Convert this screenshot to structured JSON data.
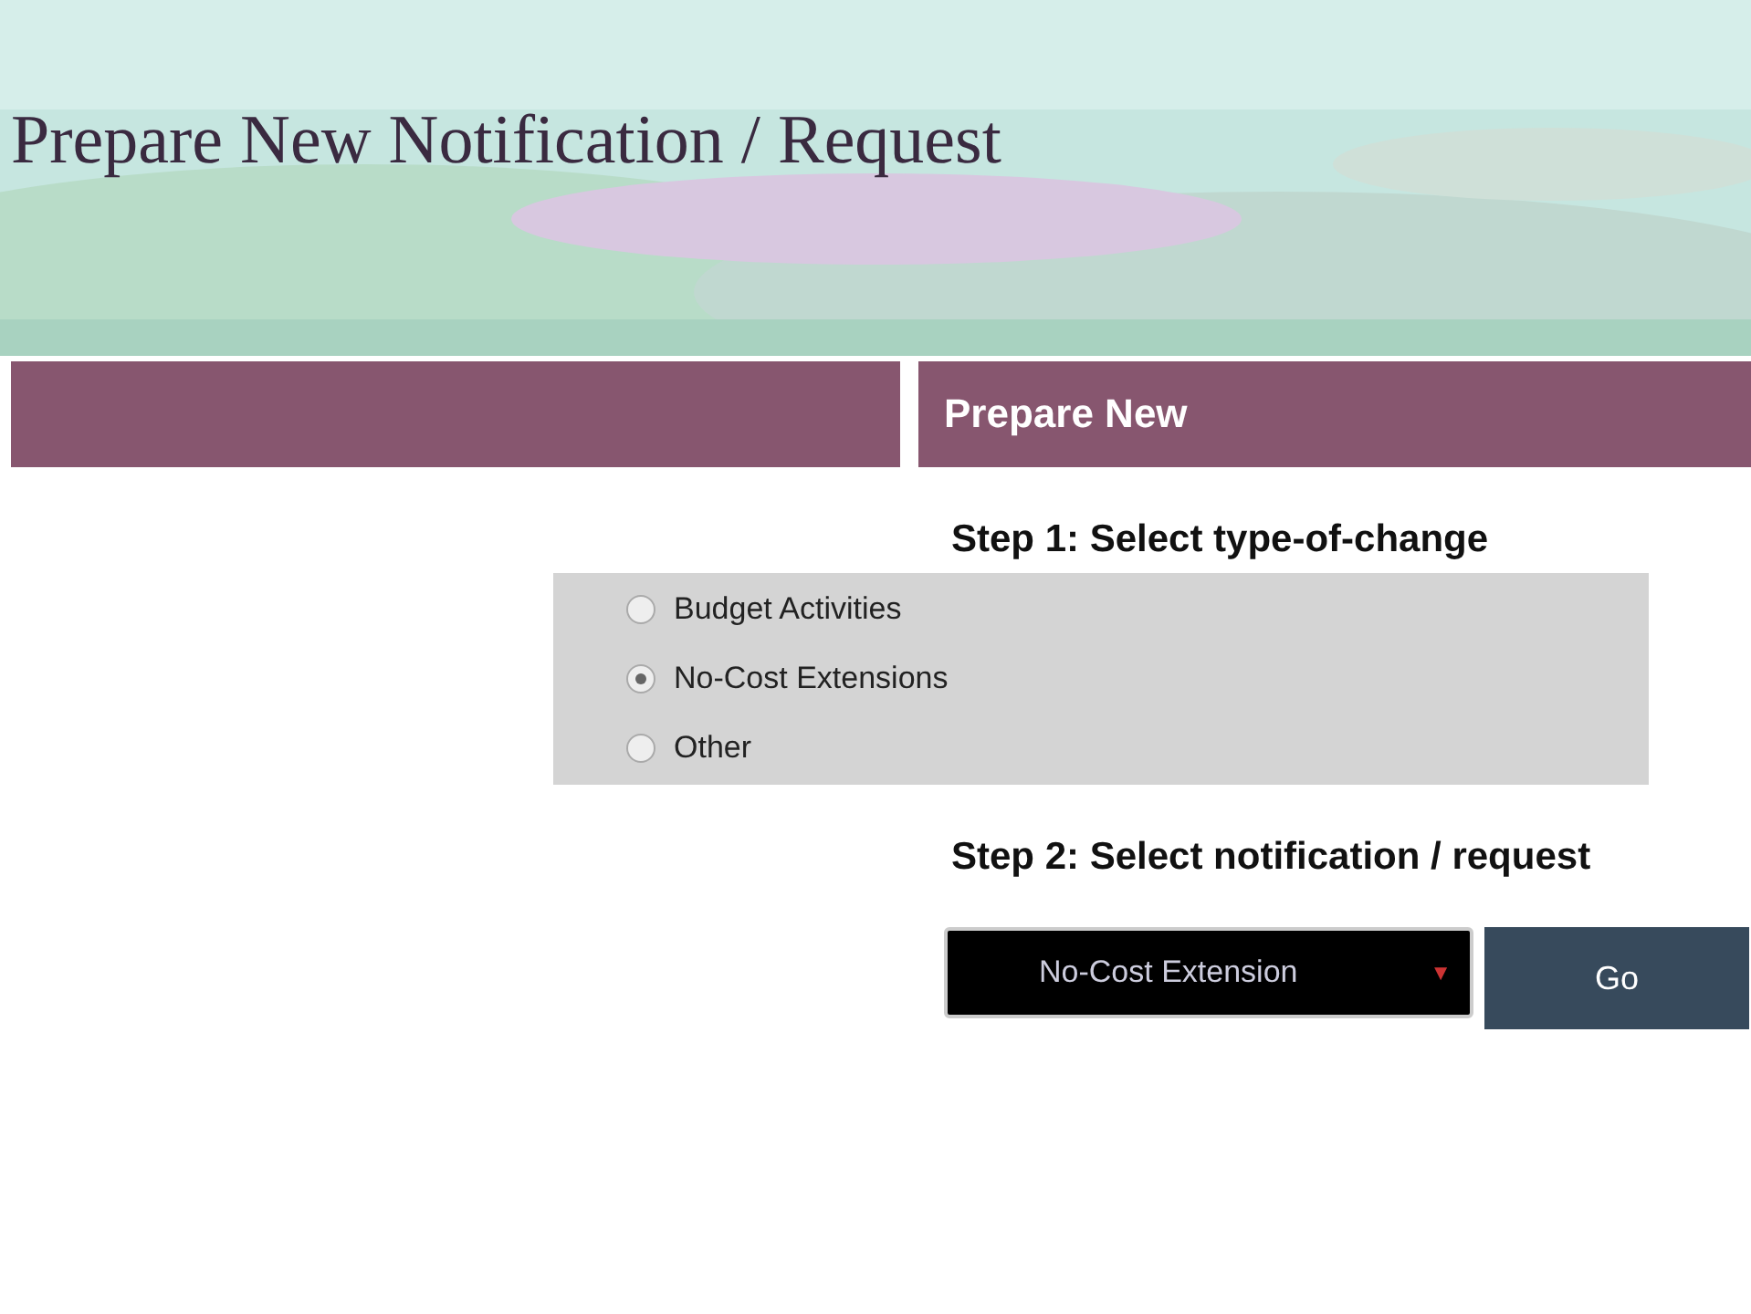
{
  "banner": {
    "title": "Prepare New Notification / Request"
  },
  "panel": {
    "title": "Prepare New",
    "step_1": "Step 1: Select type-of-change",
    "options": [
      {
        "label": "Budget Activities",
        "selected": false
      },
      {
        "label": "No-Cost Extensions",
        "selected": true
      },
      {
        "label": "Other",
        "selected": false
      }
    ],
    "step_2": "Step 2: Select notification / request",
    "select": {
      "value": "No-Cost Extension",
      "arrow": "▼"
    },
    "go_button": "Go"
  }
}
